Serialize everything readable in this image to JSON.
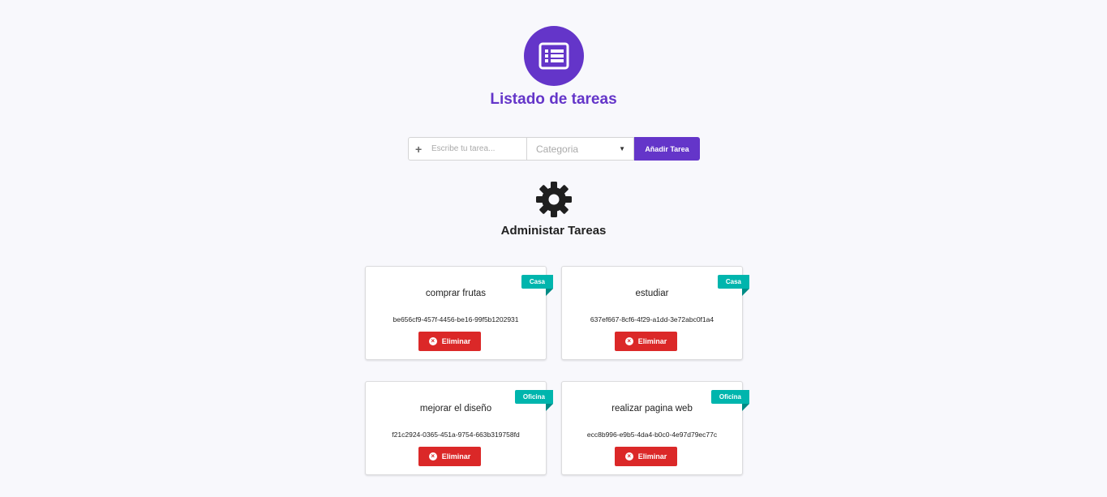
{
  "header": {
    "icon": "list-alt-icon",
    "title": "Listado de tareas"
  },
  "form": {
    "input_placeholder": "Escribe tu tarea...",
    "input_icon": "plus-icon",
    "select_value": "Categoria",
    "add_label": "Añadir Tarea"
  },
  "section": {
    "icon": "gear-icon",
    "title": "Administar Tareas"
  },
  "colors": {
    "primary": "#6435c9",
    "ribbon": "#00b5ad",
    "danger": "#db2828"
  },
  "tasks": [
    {
      "category": "Casa",
      "title": "comprar frutas",
      "id": "be656cf9-457f-4456-be16-99f5b1202931",
      "delete_label": "Eliminar"
    },
    {
      "category": "Casa",
      "title": "estudiar",
      "id": "637ef667-8cf6-4f29-a1dd-3e72abc0f1a4",
      "delete_label": "Eliminar"
    },
    {
      "category": "Oficina",
      "title": "mejorar el diseño",
      "id": "f21c2924-0365-451a-9754-663b319758fd",
      "delete_label": "Eliminar"
    },
    {
      "category": "Oficina",
      "title": "realizar pagina web",
      "id": "ecc8b996-e9b5-4da4-b0c0-4e97d79ec77c",
      "delete_label": "Eliminar"
    }
  ]
}
